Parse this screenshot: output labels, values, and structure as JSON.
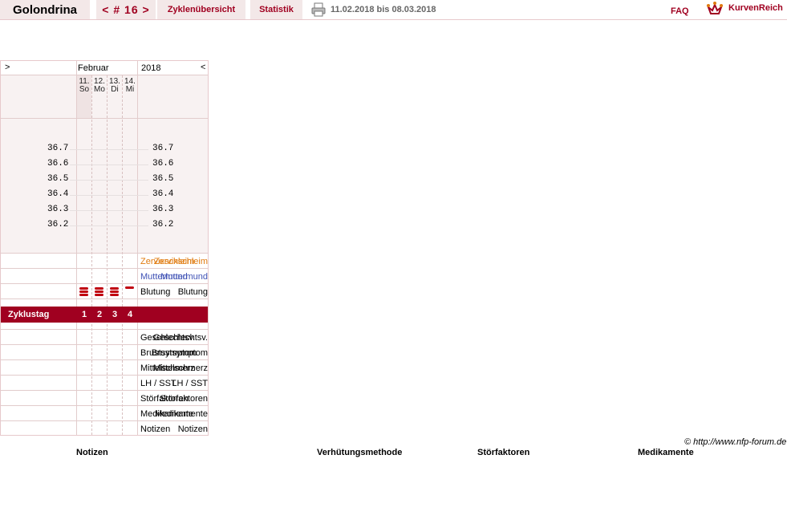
{
  "header": {
    "user": "Golondrina",
    "cycle_nav": "< # 16 >",
    "overview_tab": "Zyklenübersicht",
    "stats_tab": "Statistik",
    "date_range": "11.02.2018 bis 08.03.2018",
    "faq": "FAQ",
    "logo": "KurvenReich",
    "print_icon": "printer-icon"
  },
  "chart": {
    "nav_prev": ">",
    "nav_next": "<",
    "month": "Februar",
    "year": "2018",
    "days": [
      {
        "num": "11.",
        "wd": "So"
      },
      {
        "num": "12.",
        "wd": "Mo"
      },
      {
        "num": "13.",
        "wd": "Di"
      },
      {
        "num": "14.",
        "wd": "Mi"
      }
    ],
    "temperatures": [
      "36.7",
      "36.6",
      "36.5",
      "36.4",
      "36.3",
      "36.2"
    ],
    "rows": {
      "cervix": "Zervixschleim",
      "os": "Muttermund",
      "bleeding": "Blutung",
      "cycle_day": "Zyklustag",
      "intercourse": "Geschlechtsv.",
      "breast": "Brustsymptom",
      "midpain": "Mittelschmerz",
      "lh": "LH / SST",
      "disturb": "Störfaktoren",
      "meds": "Medikamente",
      "notes": "Notizen"
    },
    "bleeding_levels": [
      3,
      3,
      3,
      1
    ],
    "cycle_days": [
      "1",
      "2",
      "3",
      "4"
    ],
    "colors": {
      "accent": "#a00020",
      "cervix": "#e07b10",
      "os": "#3f52b5",
      "bleeding": "#c00010"
    }
  },
  "footer": {
    "copyright": "© http://www.nfp-forum.de",
    "headings": {
      "notes": "Notizen",
      "method": "Verhütungsmethode",
      "disturb": "Störfaktoren",
      "meds": "Medikamente"
    }
  }
}
